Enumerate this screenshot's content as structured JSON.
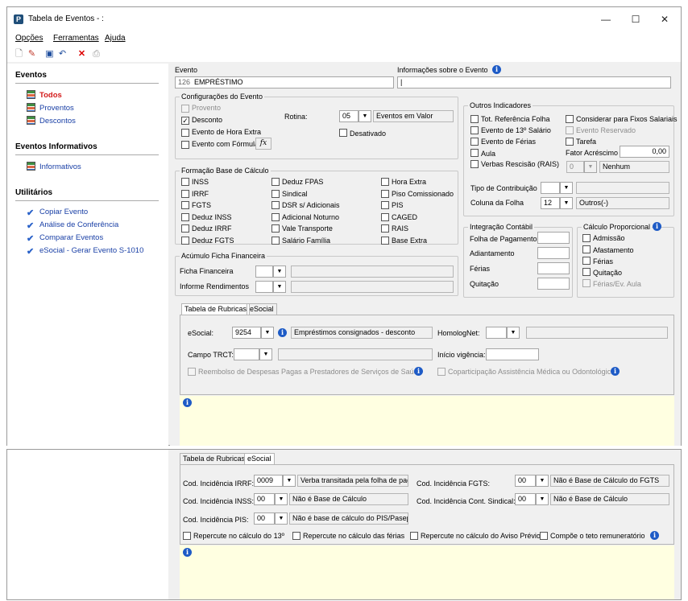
{
  "window": {
    "title": "Tabela de Eventos - :",
    "logo": "P"
  },
  "menu": [
    "Opções",
    "Ferramentas",
    "Ajuda"
  ],
  "sidebar": {
    "eventos_title": "Eventos",
    "eventos": [
      "Todos",
      "Proventos",
      "Descontos"
    ],
    "informativos_title": "Eventos Informativos",
    "informativos": [
      "Informativos"
    ],
    "utilitarios_title": "Utilitários",
    "utilitarios": [
      "Copiar Evento",
      "Análise de Conferência",
      "Comparar Eventos",
      "eSocial - Gerar Evento S-1010"
    ]
  },
  "evento": {
    "label": "Evento",
    "codigo": "126",
    "nome": "EMPRÉSTIMO",
    "info_label": "Informações sobre o Evento",
    "info_value": "|"
  },
  "config": {
    "title": "Configurações do Evento",
    "provento": "Provento",
    "desconto": "Desconto",
    "hora_extra": "Evento de Hora Extra",
    "formula": "Evento com Fórmula",
    "fx": "fx",
    "rotina_label": "Rotina:",
    "rotina_code": "05",
    "rotina_desc": "Eventos em Valor",
    "desativado": "Desativado"
  },
  "outros": {
    "title": "Outros Indicadores",
    "tot_ref": "Tot. Referência Folha",
    "considerar": "Considerar para Fixos Salariais",
    "decimo": "Evento de 13º Salário",
    "reservado": "Evento Reservado",
    "ferias": "Evento de Férias",
    "tarefa": "Tarefa",
    "aula": "Aula",
    "fator_label": "Fator Acréscimo",
    "fator_value": "0,00",
    "verbas": "Verbas Rescisão (RAIS)",
    "verbas_code": "0",
    "verbas_desc": "Nenhum",
    "tipo_contrib": "Tipo de Contribuição",
    "coluna": "Coluna da Folha",
    "coluna_code": "12",
    "coluna_desc": "Outros(-)"
  },
  "formacao": {
    "title": "Formação Base de Cálculo",
    "col1": [
      "INSS",
      "IRRF",
      "FGTS",
      "Deduz INSS",
      "Deduz IRRF",
      "Deduz FGTS"
    ],
    "col2": [
      "Deduz FPAS",
      "Sindical",
      "DSR s/ Adicionais",
      "Adicional Noturno",
      "Vale Transporte",
      "Salário Família"
    ],
    "col3": [
      "Hora Extra",
      "Piso Comissionado",
      "PIS",
      "CAGED",
      "RAIS",
      "Base Extra"
    ]
  },
  "integracao": {
    "title": "Integração Contábil",
    "items": [
      "Folha de Pagamento",
      "Adiantamento",
      "Férias",
      "Quitação"
    ]
  },
  "proporcional": {
    "title": "Cálculo Proporcional",
    "items": [
      "Admissão",
      "Afastamento",
      "Férias",
      "Quitação"
    ],
    "ferias_aula": "Férias/Ev. Aula"
  },
  "acumulo": {
    "title": "Acúmulo Ficha Financeira",
    "ficha": "Ficha Financeira",
    "informe": "Informe Rendimentos"
  },
  "tabs": [
    "Tabela de Rubricas",
    "eSocial"
  ],
  "rubricas": {
    "esocial_label": "eSocial:",
    "esocial_code": "9254",
    "esocial_desc": "Empréstimos consignados - desconto",
    "homolognet": "HomologNet:",
    "trct": "Campo TRCT:",
    "inicio": "Início vigência:",
    "reembolso": "Reembolso de Despesas Pagas a Prestadores de Serviços de Saúde",
    "copart": "Coparticipação Assistência Médica ou Odontológica"
  },
  "esocial_tab": {
    "irrf_label": "Cod. Incidência IRRF:",
    "irrf_code": "0009",
    "irrf_desc": "Verba transitada pela folha de paga",
    "fgts_label": "Cod. Incidência FGTS:",
    "fgts_code": "00",
    "fgts_desc": "Não é Base de Cálculo do FGTS",
    "inss_label": "Cod. Incidência INSS:",
    "inss_code": "00",
    "inss_desc": "Não é Base de Cálculo",
    "sind_label": "Cod. Incidência Cont. Sindical:",
    "sind_code": "00",
    "sind_desc": "Não é Base de Cálculo",
    "pis_label": "Cod. Incidência PIS:",
    "pis_code": "00",
    "pis_desc": "Não é base de cálculo do PIS/Pasep",
    "rep13": "Repercute no cálculo do 13º",
    "repferias": "Repercute no cálculo das férias",
    "repaviso": "Repercute no cálculo do Aviso Prévio",
    "teto": "Compõe o teto remuneratório"
  }
}
